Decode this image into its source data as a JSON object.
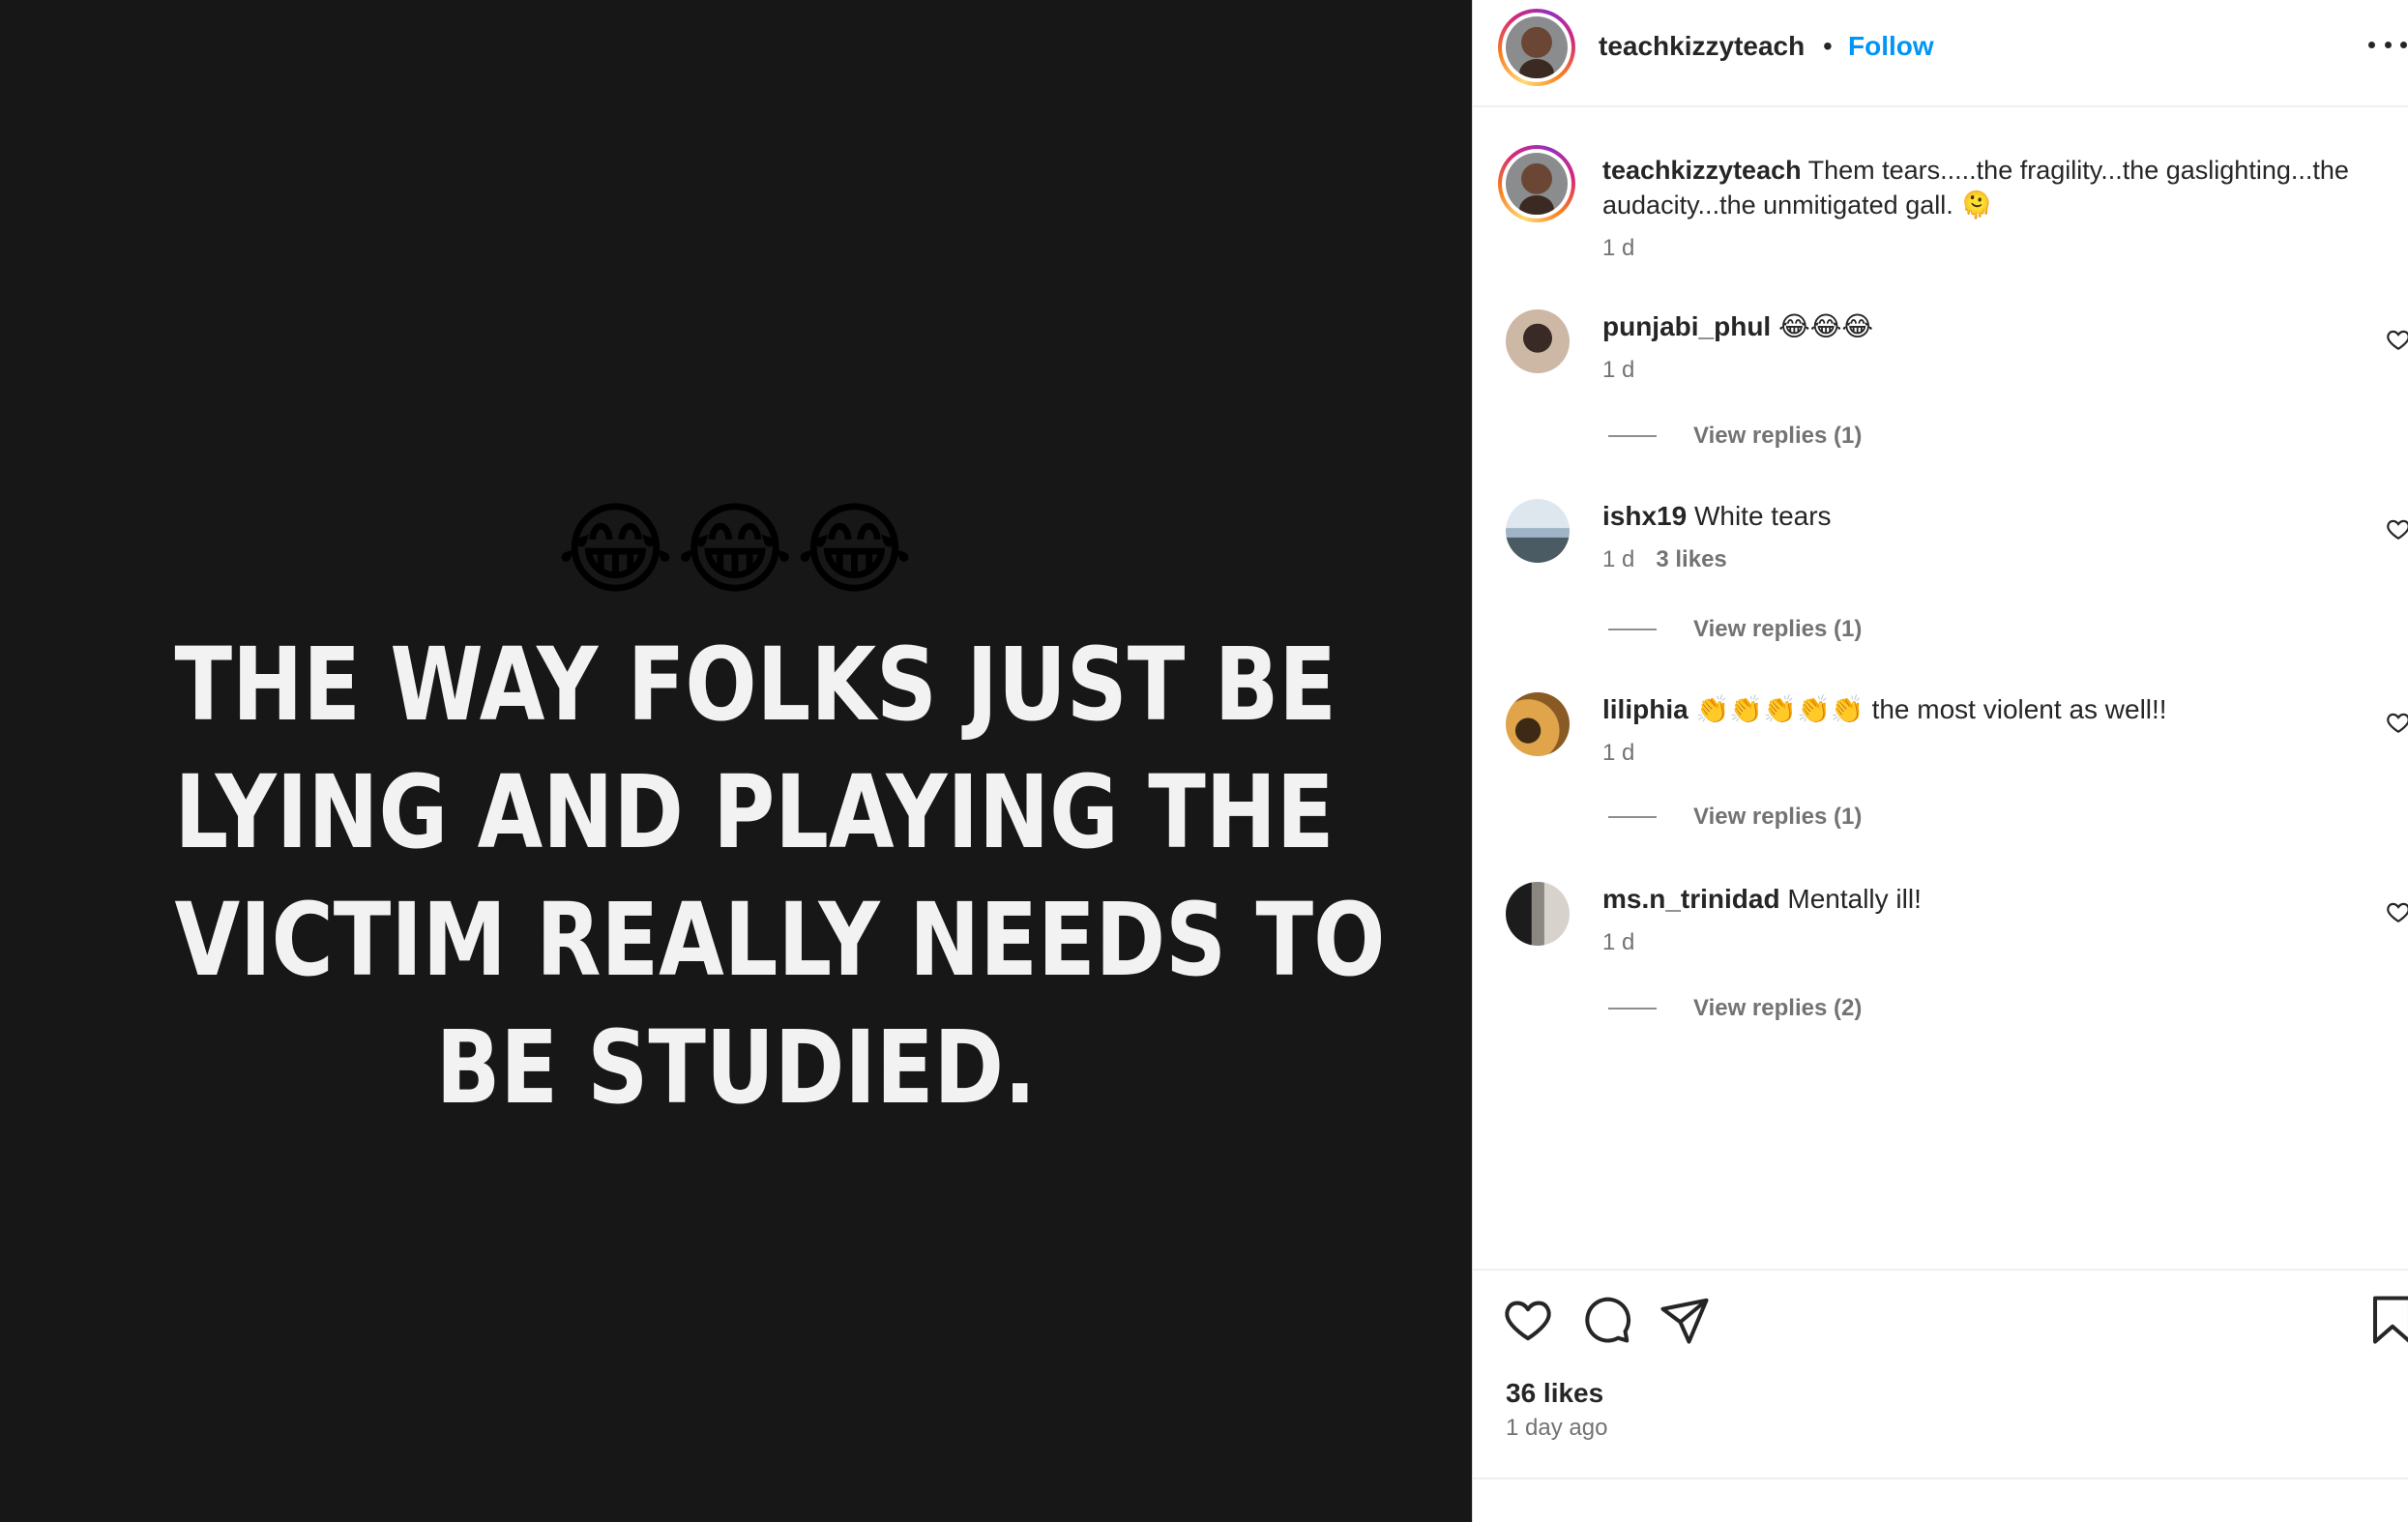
{
  "media": {
    "emojis": "😂😂😂",
    "text_lines": [
      "THE WAY FOLKS JUST BE",
      "LYING AND PLAYING THE",
      "VICTIM REALLY NEEDS TO",
      "BE STUDIED."
    ]
  },
  "header": {
    "username": "teachkizzyteach",
    "separator": "•",
    "follow_label": "Follow"
  },
  "caption": {
    "username": "teachkizzyteach",
    "text_line1": " Them tears.....the fragility...the gaslighting...the",
    "text_line2": "audacity...the unmitigated gall. 🫠",
    "time": "1 d"
  },
  "comments": [
    {
      "username": "punjabi_phul",
      "text": " 😂😂😂",
      "time": "1 d",
      "likes": "",
      "replies": "View replies (1)"
    },
    {
      "username": "ishx19",
      "text": " White tears",
      "time": "1 d",
      "likes": "3 likes",
      "replies": "View replies (1)"
    },
    {
      "username": "liliphia",
      "text": " 👏👏👏👏👏 the most violent as well!!",
      "time": "1 d",
      "likes": "",
      "replies": "View replies (1)"
    },
    {
      "username": "ms.n_trinidad",
      "text": " Mentally ill!",
      "time": "1 d",
      "likes": "",
      "replies": "View replies (2)"
    }
  ],
  "footer": {
    "likes": "36 likes",
    "posted": "1 day ago"
  },
  "icons": {
    "like": "heart-icon",
    "comment": "comment-bubble-icon",
    "share": "paper-plane-icon",
    "save": "bookmark-icon",
    "more": "more-options-icon"
  }
}
